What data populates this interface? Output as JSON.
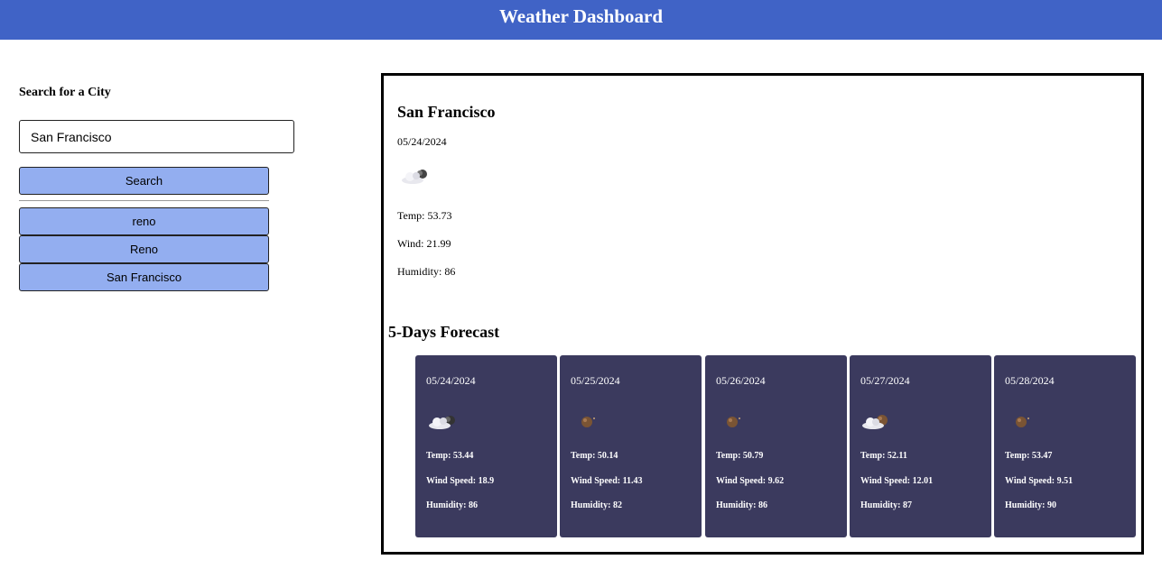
{
  "header": {
    "title": "Weather Dashboard"
  },
  "search": {
    "label": "Search for a City",
    "input_value": "San Francisco",
    "button_label": "Search"
  },
  "history": [
    "reno",
    "Reno",
    "San Francisco"
  ],
  "current": {
    "city": "San Francisco",
    "date": "05/24/2024",
    "icon": "cloudy-night-icon",
    "temp": "Temp: 53.73",
    "wind": "Wind: 21.99",
    "humidity": "Humidity: 86"
  },
  "forecast": {
    "title": "5-Days Forecast",
    "days": [
      {
        "date": "05/24/2024",
        "icon": "cloudy-night-icon",
        "temp": "Temp: 53.44",
        "wind": "Wind Speed: 18.9",
        "humidity": "Humidity: 86"
      },
      {
        "date": "05/25/2024",
        "icon": "clear-night-icon",
        "temp": "Temp: 50.14",
        "wind": "Wind Speed: 11.43",
        "humidity": "Humidity: 82"
      },
      {
        "date": "05/26/2024",
        "icon": "clear-night-icon",
        "temp": "Temp: 50.79",
        "wind": "Wind Speed: 9.62",
        "humidity": "Humidity: 86"
      },
      {
        "date": "05/27/2024",
        "icon": "partly-cloudy-night-icon",
        "temp": "Temp: 52.11",
        "wind": "Wind Speed: 12.01",
        "humidity": "Humidity: 87"
      },
      {
        "date": "05/28/2024",
        "icon": "clear-night-icon",
        "temp": "Temp: 53.47",
        "wind": "Wind Speed: 9.51",
        "humidity": "Humidity: 90"
      }
    ]
  },
  "colors": {
    "header_bg": "#4063c6",
    "button_bg": "#93aef0",
    "card_bg": "#3b3a5e"
  }
}
